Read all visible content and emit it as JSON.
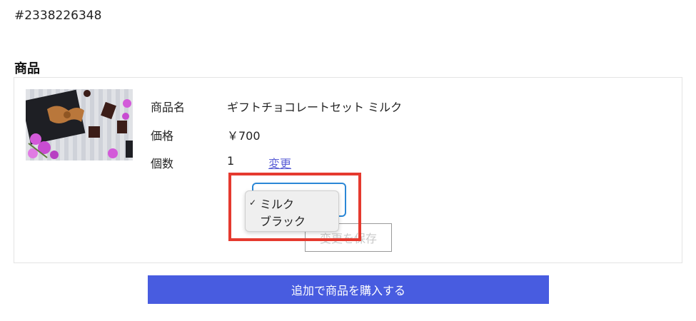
{
  "order": {
    "id": "#2338226348"
  },
  "section": {
    "title": "商品"
  },
  "product": {
    "image_desc": "chocolate-gift-photo",
    "name_label": "商品名",
    "name_value": "ギフトチョコレートセット ミルク",
    "price_label": "価格",
    "price_value": "￥700",
    "qty_label": "個数",
    "qty_value": "1",
    "change_link": "変更"
  },
  "variant_select": {
    "options": [
      "ミルク",
      "ブラック"
    ],
    "selected": "ミルク",
    "check_mark": "✓"
  },
  "save_button": {
    "label": "変更を保存"
  },
  "buy_more_button": {
    "label": "追加で商品を購入する"
  },
  "colors": {
    "accent": "#485ce0",
    "link": "#5b5fd6",
    "highlight": "#e53a2f",
    "focus_border": "#2b87d6"
  }
}
